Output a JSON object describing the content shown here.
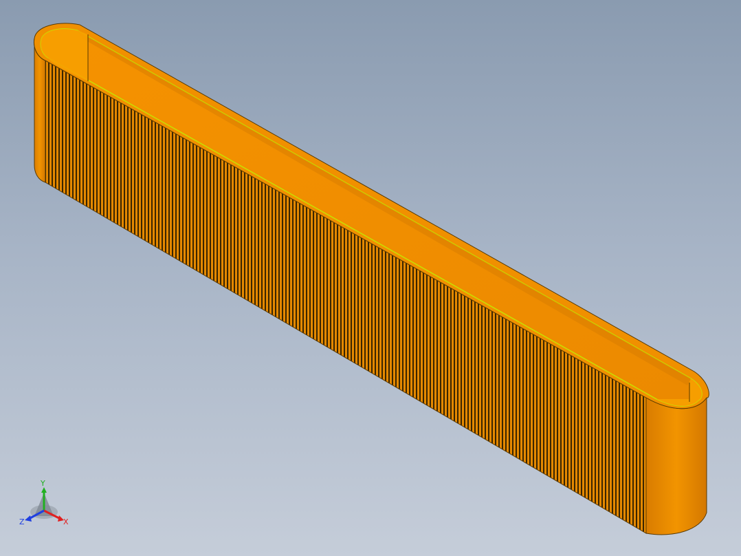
{
  "viewport": {
    "background_top": "#8a9bb0",
    "background_bottom": "#c5cdd9"
  },
  "model": {
    "shape": "rounded slot belt",
    "body_color": "#ef8d00",
    "shadow_color": "#c06e00",
    "edge_color": "#5a3a00",
    "highlight_edge_color": "#c8e000",
    "hatch_color": "#3a2500"
  },
  "triad": {
    "x_label": "X",
    "y_label": "Y",
    "z_label": "Z",
    "x_color": "#e02020",
    "y_color": "#20b020",
    "z_color": "#2040e0"
  }
}
